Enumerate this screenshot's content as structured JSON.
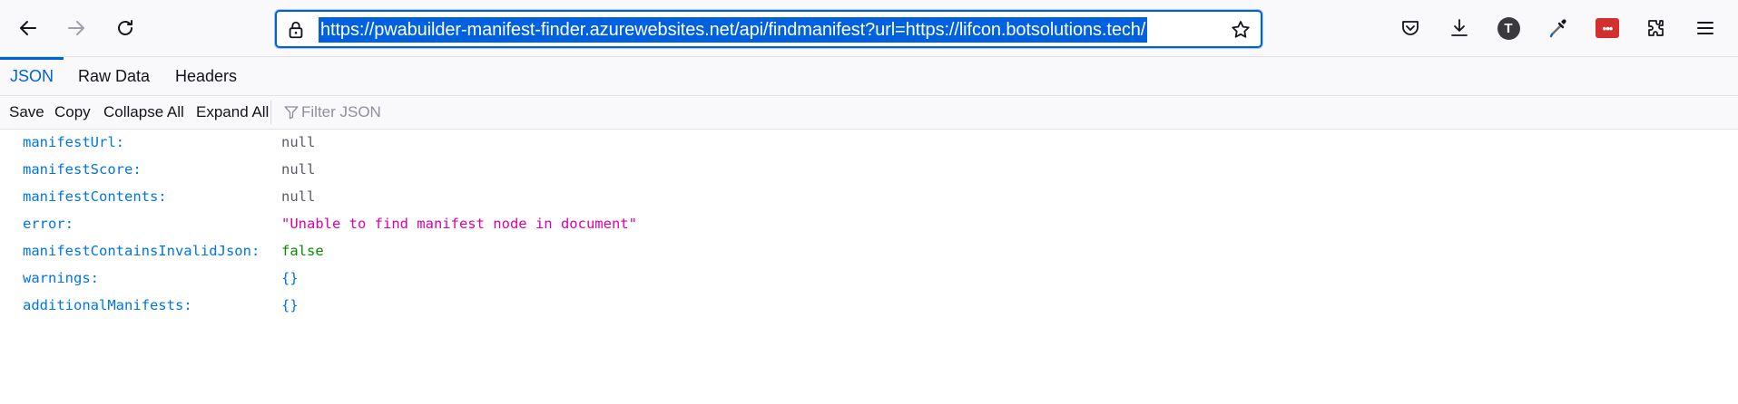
{
  "browser": {
    "url": "https://pwabuilder-manifest-finder.azurewebsites.net/api/findmanifest?url=https://lifcon.botsolutions.tech/",
    "avatar_letter": "T",
    "ext_badge": "•••",
    "icons": {
      "back": "arrow-left-icon",
      "forward": "arrow-right-icon",
      "reload": "reload-icon",
      "lock": "lock-icon",
      "bookmark": "star-icon",
      "pocket": "pocket-icon",
      "downloads": "download-icon",
      "eyedropper": "eyedropper-icon",
      "extensions": "puzzle-icon",
      "menu": "hamburger-menu-icon"
    },
    "colors": {
      "accent": "#0061e0",
      "extension_red": "#d32f2f"
    }
  },
  "viewer": {
    "tabs": [
      {
        "label": "JSON",
        "active": true
      },
      {
        "label": "Raw Data",
        "active": false
      },
      {
        "label": "Headers",
        "active": false
      }
    ],
    "toolbar": {
      "save": "Save",
      "copy": "Copy",
      "collapse_all": "Collapse All",
      "expand_all": "Expand All",
      "filter_placeholder": "Filter JSON"
    },
    "rows": [
      {
        "key": "manifestUrl:",
        "value": "null",
        "type": "null"
      },
      {
        "key": "manifestScore:",
        "value": "null",
        "type": "null"
      },
      {
        "key": "manifestContents:",
        "value": "null",
        "type": "null"
      },
      {
        "key": "error:",
        "value": "\"Unable to find manifest node in document\"",
        "type": "string"
      },
      {
        "key": "manifestContainsInvalidJson:",
        "value": "false",
        "type": "bool"
      },
      {
        "key": "warnings:",
        "value": "{}",
        "type": "object"
      },
      {
        "key": "additionalManifests:",
        "value": "{}",
        "type": "object"
      }
    ],
    "colors": {
      "key": "#0074e8",
      "null": "#5b5b66",
      "string": "#dd00a9",
      "bool": "#058b00"
    }
  }
}
